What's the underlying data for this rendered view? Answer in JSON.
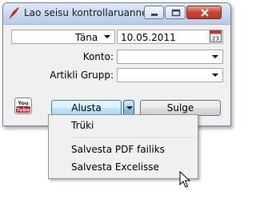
{
  "window": {
    "title": "Lao seisu kontrollaruanne"
  },
  "form": {
    "date_mode": {
      "value": "Täna"
    },
    "date": {
      "value": "10.05.2011"
    },
    "konto": {
      "label": "Konto:",
      "value": ""
    },
    "artikli_grupp": {
      "label": "Artikli Grupp:",
      "value": ""
    }
  },
  "buttons": {
    "start": "Alusta",
    "close": "Sulge"
  },
  "youtube": {
    "top": "You",
    "bottom": "Tube"
  },
  "start_menu": {
    "items": [
      "Trüki",
      "Salvesta PDF failiks",
      "Salvesta Excelisse"
    ]
  },
  "colors": {
    "titlebar": "#c6d7ee",
    "close_button": "#c7452f",
    "start_button": "#bee6fd",
    "youtube_red": "#cc181e"
  }
}
